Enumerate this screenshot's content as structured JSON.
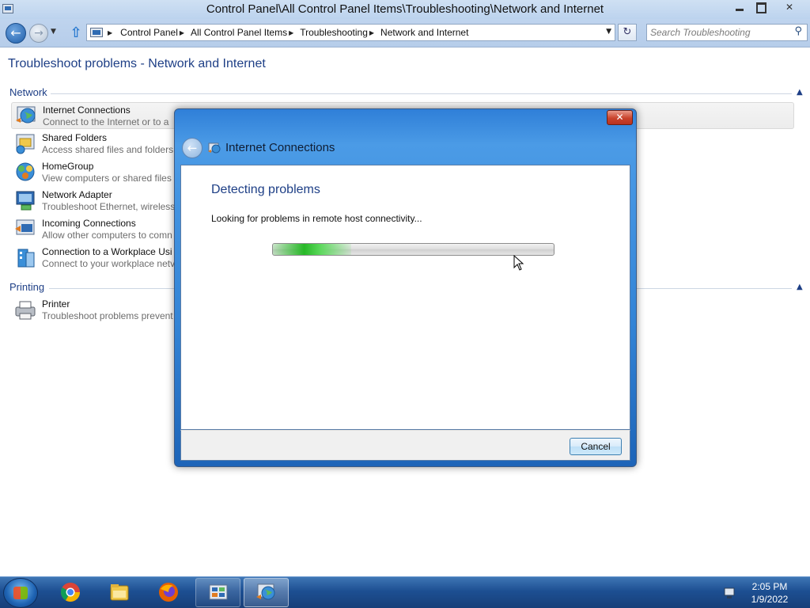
{
  "window": {
    "title": "Control Panel\\All Control Panel Items\\Troubleshooting\\Network and Internet",
    "min_glyph": "",
    "max_glyph": "",
    "close_glyph": "✕"
  },
  "navigation": {
    "back_glyph": "←",
    "forward_glyph": "→",
    "dropdown_glyph": "▼",
    "up_glyph": "⇧",
    "breadcrumbs": [
      "Control Panel",
      "All Control Panel Items",
      "Troubleshooting",
      "Network and Internet"
    ],
    "breadcrumb_separator": "▶",
    "address_dropdown_glyph": "▼",
    "refresh_glyph": "↻",
    "search_placeholder": "Search Troubleshooting",
    "search_glyph": "⚲"
  },
  "page": {
    "title": "Troubleshoot problems - Network and Internet",
    "collapse_glyph": "▲",
    "groups": [
      {
        "header": "Network",
        "items": [
          {
            "name": "Internet Connections",
            "desc": "Connect to the Internet or to a",
            "icon": "internet-connections-icon"
          },
          {
            "name": "Shared Folders",
            "desc": "Access shared files and folders",
            "icon": "shared-folders-icon"
          },
          {
            "name": "HomeGroup",
            "desc": "View computers or shared files",
            "icon": "homegroup-icon"
          },
          {
            "name": "Network Adapter",
            "desc": "Troubleshoot Ethernet, wireless",
            "icon": "network-adapter-icon"
          },
          {
            "name": "Incoming Connections",
            "desc": "Allow other computers to comn",
            "icon": "incoming-connections-icon"
          },
          {
            "name": "Connection to a Workplace Usi",
            "desc": "Connect to your workplace netv",
            "icon": "workplace-connection-icon"
          }
        ]
      },
      {
        "header": "Printing",
        "items": [
          {
            "name": "Printer",
            "desc": "Troubleshoot problems prevent",
            "icon": "printer-icon"
          }
        ]
      }
    ]
  },
  "dialog": {
    "title": "Internet Connections",
    "close_glyph": "✕",
    "back_glyph": "←",
    "heading": "Detecting problems",
    "status": "Looking for problems in remote host connectivity...",
    "progress_fraction": 0.28,
    "cancel_label": "Cancel"
  },
  "taskbar": {
    "apps": [
      "chrome-icon",
      "file-explorer-icon",
      "firefox-icon",
      "control-panel-icon",
      "internet-connections-icon"
    ],
    "time": "2:05 PM",
    "date": "1/9/2022"
  },
  "colors": {
    "accent": "#1e3f86",
    "dialog_frame": "#3384d6",
    "progress_green": "#27b827"
  }
}
